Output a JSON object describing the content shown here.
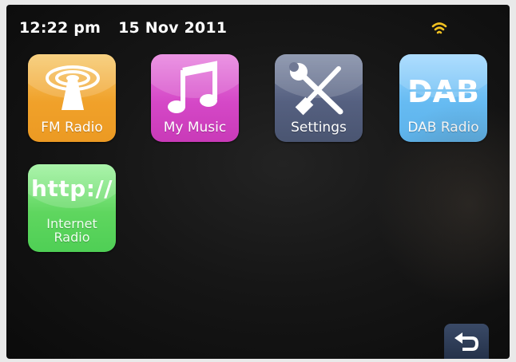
{
  "status_bar": {
    "time": "12:22 pm",
    "date": "15 Nov 2011",
    "signal_icon": "wifi-signal-icon",
    "signal_color": "#f0c020"
  },
  "apps": [
    {
      "label": "FM Radio",
      "icon": "fm-antenna-icon",
      "color": "#f0a12a"
    },
    {
      "label": "My Music",
      "icon": "music-note-icon",
      "color": "#d548c7"
    },
    {
      "label": "Settings",
      "icon": "wrench-screwdriver-icon",
      "color": "#556080"
    },
    {
      "label": "DAB Radio",
      "icon": "dab-logo-icon",
      "logo_text": "DAB",
      "color": "#66bbf2"
    },
    {
      "label_line1": "Internet",
      "label_line2": "Radio",
      "icon": "http-icon",
      "icon_text": "http://",
      "color": "#5fd65f"
    }
  ],
  "navigation": {
    "back_icon": "back-arrow-icon"
  }
}
